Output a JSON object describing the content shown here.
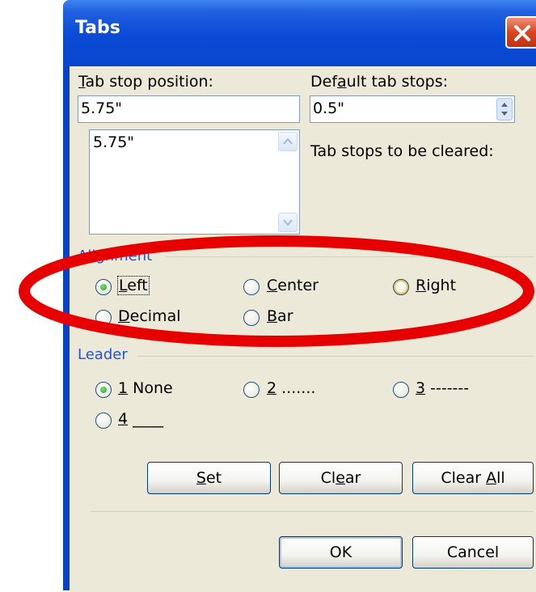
{
  "dialog": {
    "title": "Tabs",
    "close_icon": "close-icon"
  },
  "tab_stop_position": {
    "label_u": "T",
    "label_rest": "ab stop position:",
    "value": "5.75\"",
    "list_items": [
      "5.75\""
    ]
  },
  "default_tab_stops": {
    "label_a": "Def",
    "label_u": "a",
    "label_b": "ult tab stops:",
    "value": "0.5\""
  },
  "tab_stops_cleared_label": "Tab stops to be cleared:",
  "alignment": {
    "group_label": "Alignment",
    "options": [
      {
        "u": "L",
        "rest": "eft",
        "checked": true
      },
      {
        "u": "C",
        "rest": "enter",
        "checked": false
      },
      {
        "u": "R",
        "rest": "ight",
        "checked": false
      },
      {
        "u": "D",
        "rest": "ecimal",
        "checked": false
      },
      {
        "u": "B",
        "rest": "ar",
        "checked": false
      }
    ]
  },
  "leader": {
    "group_label": "Leader",
    "options": [
      {
        "u": "1",
        "rest": " None",
        "checked": true
      },
      {
        "u": "2",
        "rest": " .......",
        "checked": false
      },
      {
        "u": "3",
        "rest": " -------",
        "checked": false
      },
      {
        "u": "4",
        "rest": " ____",
        "checked": false
      }
    ]
  },
  "buttons": {
    "set": {
      "u": "S",
      "rest": "et"
    },
    "clear": {
      "a": "Cl",
      "u": "e",
      "b": "ar"
    },
    "clear_all": {
      "a": "Clear ",
      "u": "A",
      "b": "ll"
    },
    "ok": "OK",
    "cancel": "Cancel"
  },
  "colors": {
    "titlebar": "#0a4bd6",
    "dialog_bg": "#ece9d8",
    "group_label": "#2453d8",
    "annotation_oval": "#e60000"
  }
}
